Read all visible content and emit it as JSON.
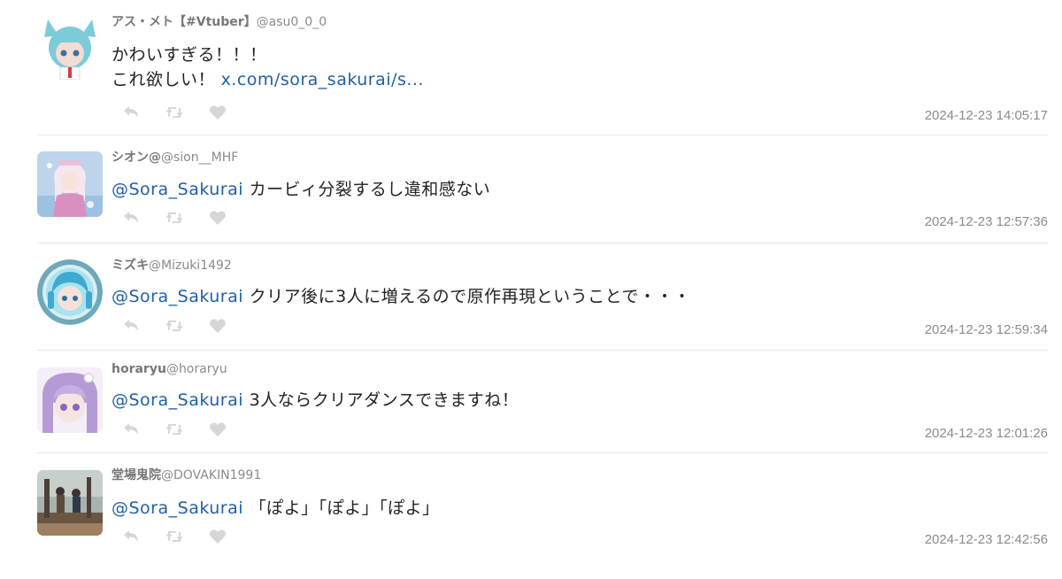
{
  "replies": [
    {
      "name": "アス・メト【#Vtuber】",
      "handle": "@asu0_0_0",
      "text_line1": "かわいすぎる！！！",
      "text_line2": "これ欲しい！",
      "link": "x.com/sora_sakurai/s...",
      "timestamp": "2024-12-23 14:05:17",
      "avatar_colors": [
        "#cfe9ef",
        "#7ccbd9",
        "#f3dcd2"
      ]
    },
    {
      "name": "シオン@",
      "handle": "@sion__MHF",
      "mention": "@Sora_Sakurai",
      "text": "カービィ分裂するし違和感ない",
      "timestamp": "2024-12-23 12:57:36",
      "avatar_colors": [
        "#bcd4ec",
        "#f5e6f0",
        "#d98fc0"
      ]
    },
    {
      "name": "ミズキ",
      "handle": "@Mizuki1492",
      "mention": "@Sora_Sakurai",
      "text": "クリア後に3人に増えるので原作再現ということで・・・",
      "timestamp": "2024-12-23 12:59:34",
      "avatar_colors": [
        "#6fa8b8",
        "#a9e2f0",
        "#40a9cf"
      ]
    },
    {
      "name": "horaryu",
      "handle": "@horaryu",
      "mention": "@Sora_Sakurai",
      "text": "3人ならクリアダンスできますね！",
      "timestamp": "2024-12-23 12:01:26",
      "avatar_colors": [
        "#e9ddf2",
        "#b59ad6",
        "#f6e4e0"
      ]
    },
    {
      "name": "堂場鬼院",
      "handle": "@DOVAKIN1991",
      "mention": "@Sora_Sakurai",
      "text": "「ぽよ」「ぽよ」「ぽよ」",
      "timestamp": "2024-12-23 12:42:56",
      "avatar_colors": [
        "#a8b3ad",
        "#5a4a3c",
        "#c9a27a"
      ]
    }
  ],
  "icons": {
    "reply": "reply-arrow-icon",
    "retweet": "retweet-icon",
    "like": "heart-icon"
  },
  "colors": {
    "link": "#1f5fa8",
    "icon": "#d6d6d6",
    "meta": "#8a8a8a",
    "divider": "#e6e6e6"
  }
}
